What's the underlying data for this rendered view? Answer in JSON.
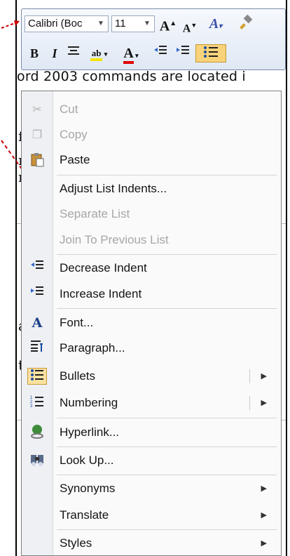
{
  "toolbar": {
    "font_name": "Calibri (Boc",
    "font_size": "11",
    "grow_font": "A",
    "shrink_font": "A",
    "bold": "B",
    "italic": "I",
    "font_color": "A",
    "highlight_color": "ab"
  },
  "document": {
    "line_text": "ord 2003 commands are located i"
  },
  "context_menu": {
    "items": [
      {
        "label": "Cut",
        "icon": "scissors-icon",
        "enabled": false
      },
      {
        "label": "Copy",
        "icon": "copy-icon",
        "enabled": false
      },
      {
        "label": "Paste",
        "icon": "paste-icon",
        "enabled": true
      },
      {
        "label": "Adjust List Indents...",
        "icon": "",
        "enabled": true
      },
      {
        "label": "Separate List",
        "icon": "",
        "enabled": false
      },
      {
        "label": "Join To Previous List",
        "icon": "",
        "enabled": false
      },
      {
        "label": "Decrease Indent",
        "icon": "decrease-indent-icon",
        "enabled": true
      },
      {
        "label": "Increase Indent",
        "icon": "increase-indent-icon",
        "enabled": true
      },
      {
        "label": "Font...",
        "icon": "font-icon",
        "enabled": true
      },
      {
        "label": "Paragraph...",
        "icon": "paragraph-icon",
        "enabled": true
      },
      {
        "label": "Bullets",
        "icon": "bullets-icon",
        "enabled": true,
        "submenu": true,
        "checked": true
      },
      {
        "label": "Numbering",
        "icon": "numbering-icon",
        "enabled": true,
        "submenu": true
      },
      {
        "label": "Hyperlink...",
        "icon": "hyperlink-icon",
        "enabled": true
      },
      {
        "label": "Look Up...",
        "icon": "lookup-icon",
        "enabled": true
      },
      {
        "label": "Synonyms",
        "icon": "",
        "enabled": true,
        "submenu": true
      },
      {
        "label": "Translate",
        "icon": "",
        "enabled": true,
        "submenu": true
      },
      {
        "label": "Styles",
        "icon": "",
        "enabled": true,
        "submenu": true
      }
    ]
  },
  "colors": {
    "annotation_arrow": "#cc0000",
    "highlight_fill": "#f8d37a"
  }
}
